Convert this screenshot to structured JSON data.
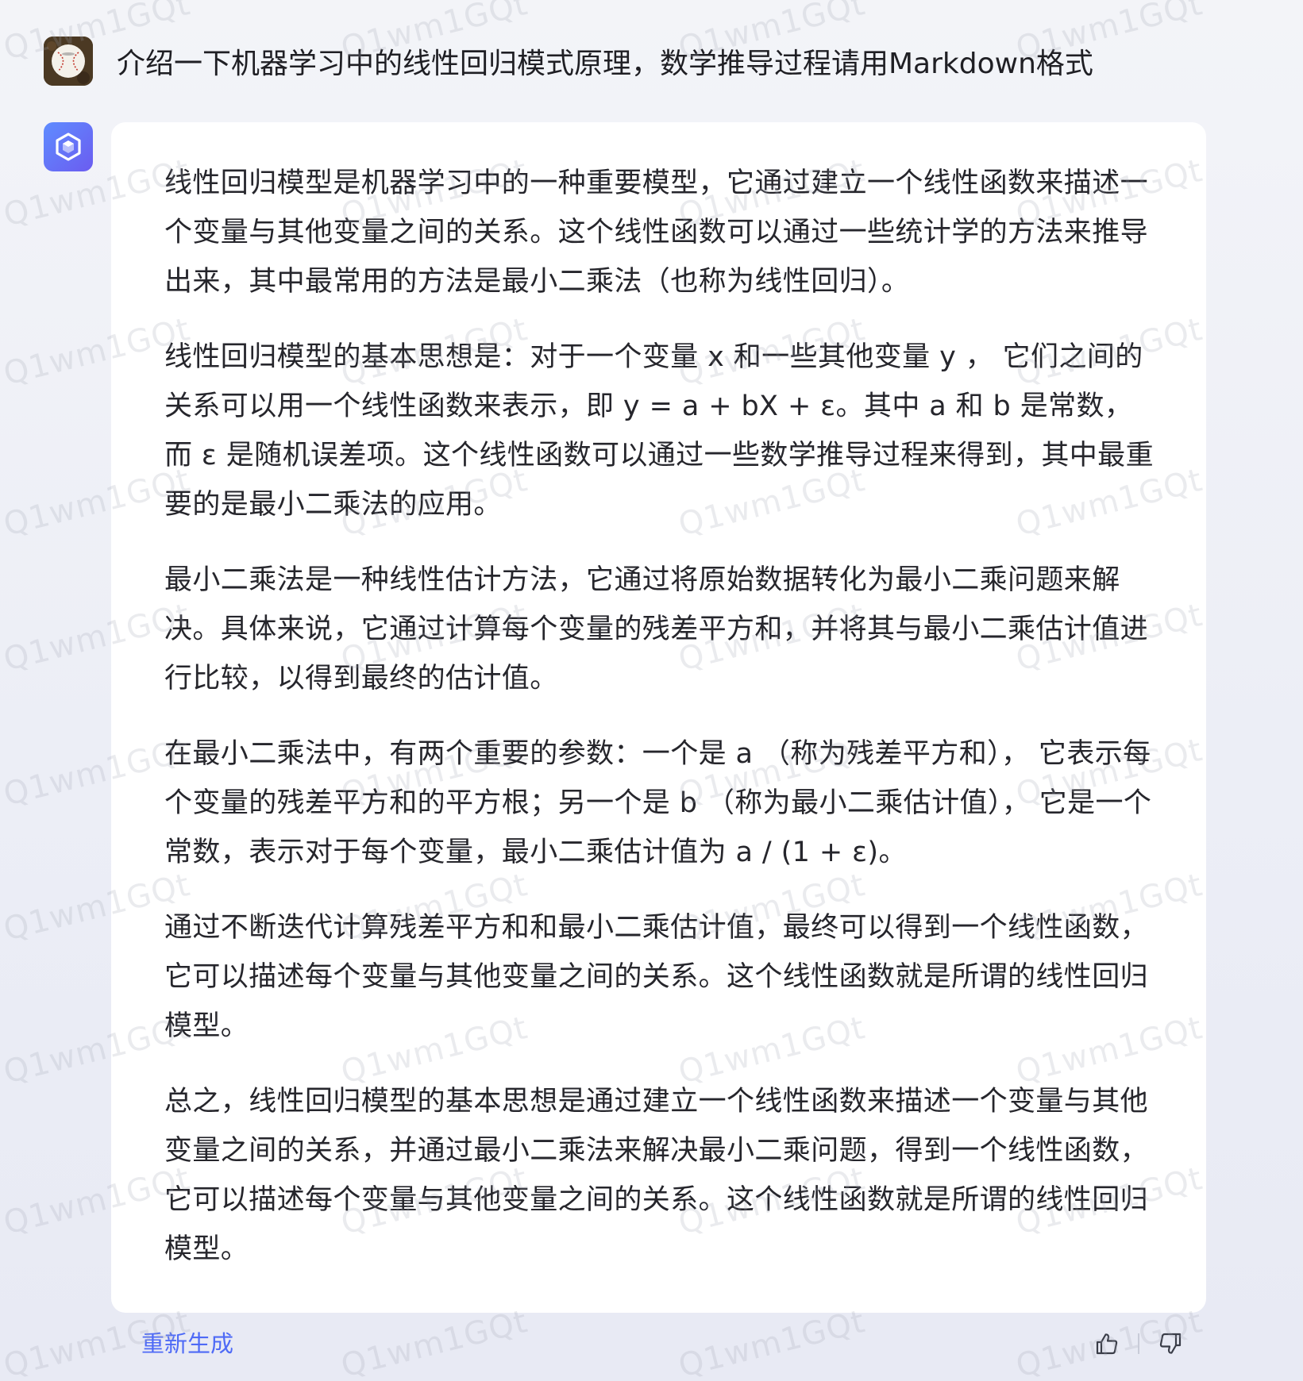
{
  "user": {
    "question": "介绍一下机器学习中的线性回归模式原理，数学推导过程请用Markdown格式"
  },
  "answer": {
    "paragraphs": [
      "线性回归模型是机器学习中的一种重要模型，它通过建立一个线性函数来描述一个变量与其他变量之间的关系。这个线性函数可以通过一些统计学的方法来推导出来，其中最常用的方法是最小二乘法（也称为线性回归）。",
      "线性回归模型的基本思想是：对于一个变量 x 和一些其他变量 y ， 它们之间的关系可以用一个线性函数来表示，即 y = a + bX + ε。其中 a 和 b 是常数，而 ε 是随机误差项。这个线性函数可以通过一些数学推导过程来得到，其中最重要的是最小二乘法的应用。",
      "最小二乘法是一种线性估计方法，它通过将原始数据转化为最小二乘问题来解决。具体来说，它通过计算每个变量的残差平方和，并将其与最小二乘估计值进行比较，以得到最终的估计值。",
      "在最小二乘法中，有两个重要的参数：一个是 a （称为残差平方和）， 它表示每个变量的残差平方和的平方根；另一个是 b （称为最小二乘估计值）， 它是一个常数，表示对于每个变量，最小二乘估计值为 a / (1 + ε)。",
      "通过不断迭代计算残差平方和和最小二乘估计值，最终可以得到一个线性函数，它可以描述每个变量与其他变量之间的关系。这个线性函数就是所谓的线性回归模型。",
      "总之，线性回归模型的基本思想是通过建立一个线性函数来描述一个变量与其他变量之间的关系，并通过最小二乘法来解决最小二乘问题，得到一个线性函数，它可以描述每个变量与其他变量之间的关系。这个线性函数就是所谓的线性回归模型。"
    ]
  },
  "footer": {
    "regenerate_label": "重新生成"
  },
  "watermark": {
    "text": "Q1wm1GQt"
  },
  "icons": {
    "user_avatar": "baseball-avatar",
    "bot_avatar": "hexagon-logo-icon",
    "like": "thumbs-up-icon",
    "dislike": "thumbs-down-icon"
  },
  "colors": {
    "accent": "#4e6af6",
    "bot_avatar_start": "#5f8cff",
    "bot_avatar_end": "#6b5cf0",
    "page_background": "#f1f2f7",
    "card_background": "#ffffff"
  }
}
